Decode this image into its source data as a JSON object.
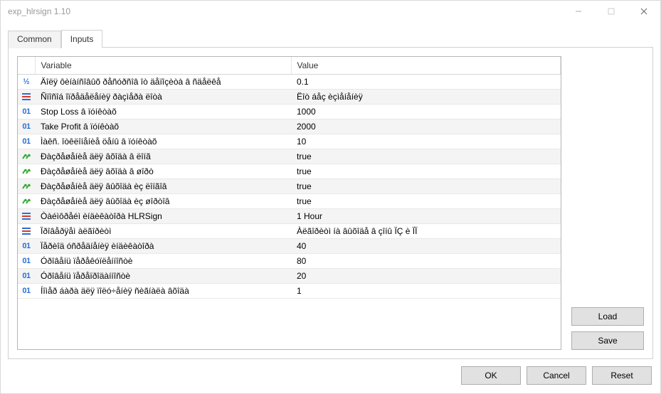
{
  "window": {
    "title": "exp_hlrsign 1.10"
  },
  "tabs": {
    "common": "Common",
    "inputs": "Inputs"
  },
  "grid": {
    "headers": {
      "variable": "Variable",
      "value": "Value"
    },
    "rows": [
      {
        "type": "double",
        "variable": "Äîëÿ ôèíàíñîâûõ ðåñóðñîâ îò äåïîçèòà â ñäåëêå",
        "value": "0.1"
      },
      {
        "type": "enum",
        "variable": "Ñïîñîá îïðåäåëåíèÿ ðàçìåðà ëîòà",
        "value": "Ëîò áåç èçìåíåíèÿ"
      },
      {
        "type": "int",
        "variable": "Stop Loss â ïóíêòàõ",
        "value": "1000"
      },
      {
        "type": "int",
        "variable": "Take Profit â ïóíêòàõ",
        "value": "2000"
      },
      {
        "type": "int",
        "variable": "Ìàêñ. îòêëîíåíèå öåíû â ïóíêòàõ",
        "value": "10"
      },
      {
        "type": "bool",
        "variable": "Ðàçðåøåíèå äëÿ âõîäà â ëîíã",
        "value": "true"
      },
      {
        "type": "bool",
        "variable": "Ðàçðåøåíèå äëÿ âõîäà â øîðò",
        "value": "true"
      },
      {
        "type": "bool",
        "variable": "Ðàçðåøåíèå äëÿ âûõîäà èç ëîíãîâ",
        "value": "true"
      },
      {
        "type": "bool",
        "variable": "Ðàçðåøåíèå äëÿ âûõîäà èç øîðòîâ",
        "value": "true"
      },
      {
        "type": "enum",
        "variable": "Òàéìôðåéì èíäèêàòîðà HLRSign",
        "value": "1 Hour"
      },
      {
        "type": "enum",
        "variable": "Ïðîâåðÿåì àëãîðèòì",
        "value": "Àëãîðèòì íà âûõîäå â çîíû ÏÇ è ÏÏ"
      },
      {
        "type": "int",
        "variable": "Ïåðèîä óñðåäíåíèÿ èíäèêàòîðà",
        "value": "40"
      },
      {
        "type": "int",
        "variable": "Óðîâåíü ïåðåêóïëåííîñòè",
        "value": "80"
      },
      {
        "type": "int",
        "variable": "Óðîâåíü ïåðåïðîäàííîñòè",
        "value": "20"
      },
      {
        "type": "int",
        "variable": "Íîìåð áàðà äëÿ ïîëó÷åíèÿ ñèãíàëà âõîäà",
        "value": "1"
      }
    ]
  },
  "buttons": {
    "load": "Load",
    "save": "Save",
    "ok": "OK",
    "cancel": "Cancel",
    "reset": "Reset"
  }
}
